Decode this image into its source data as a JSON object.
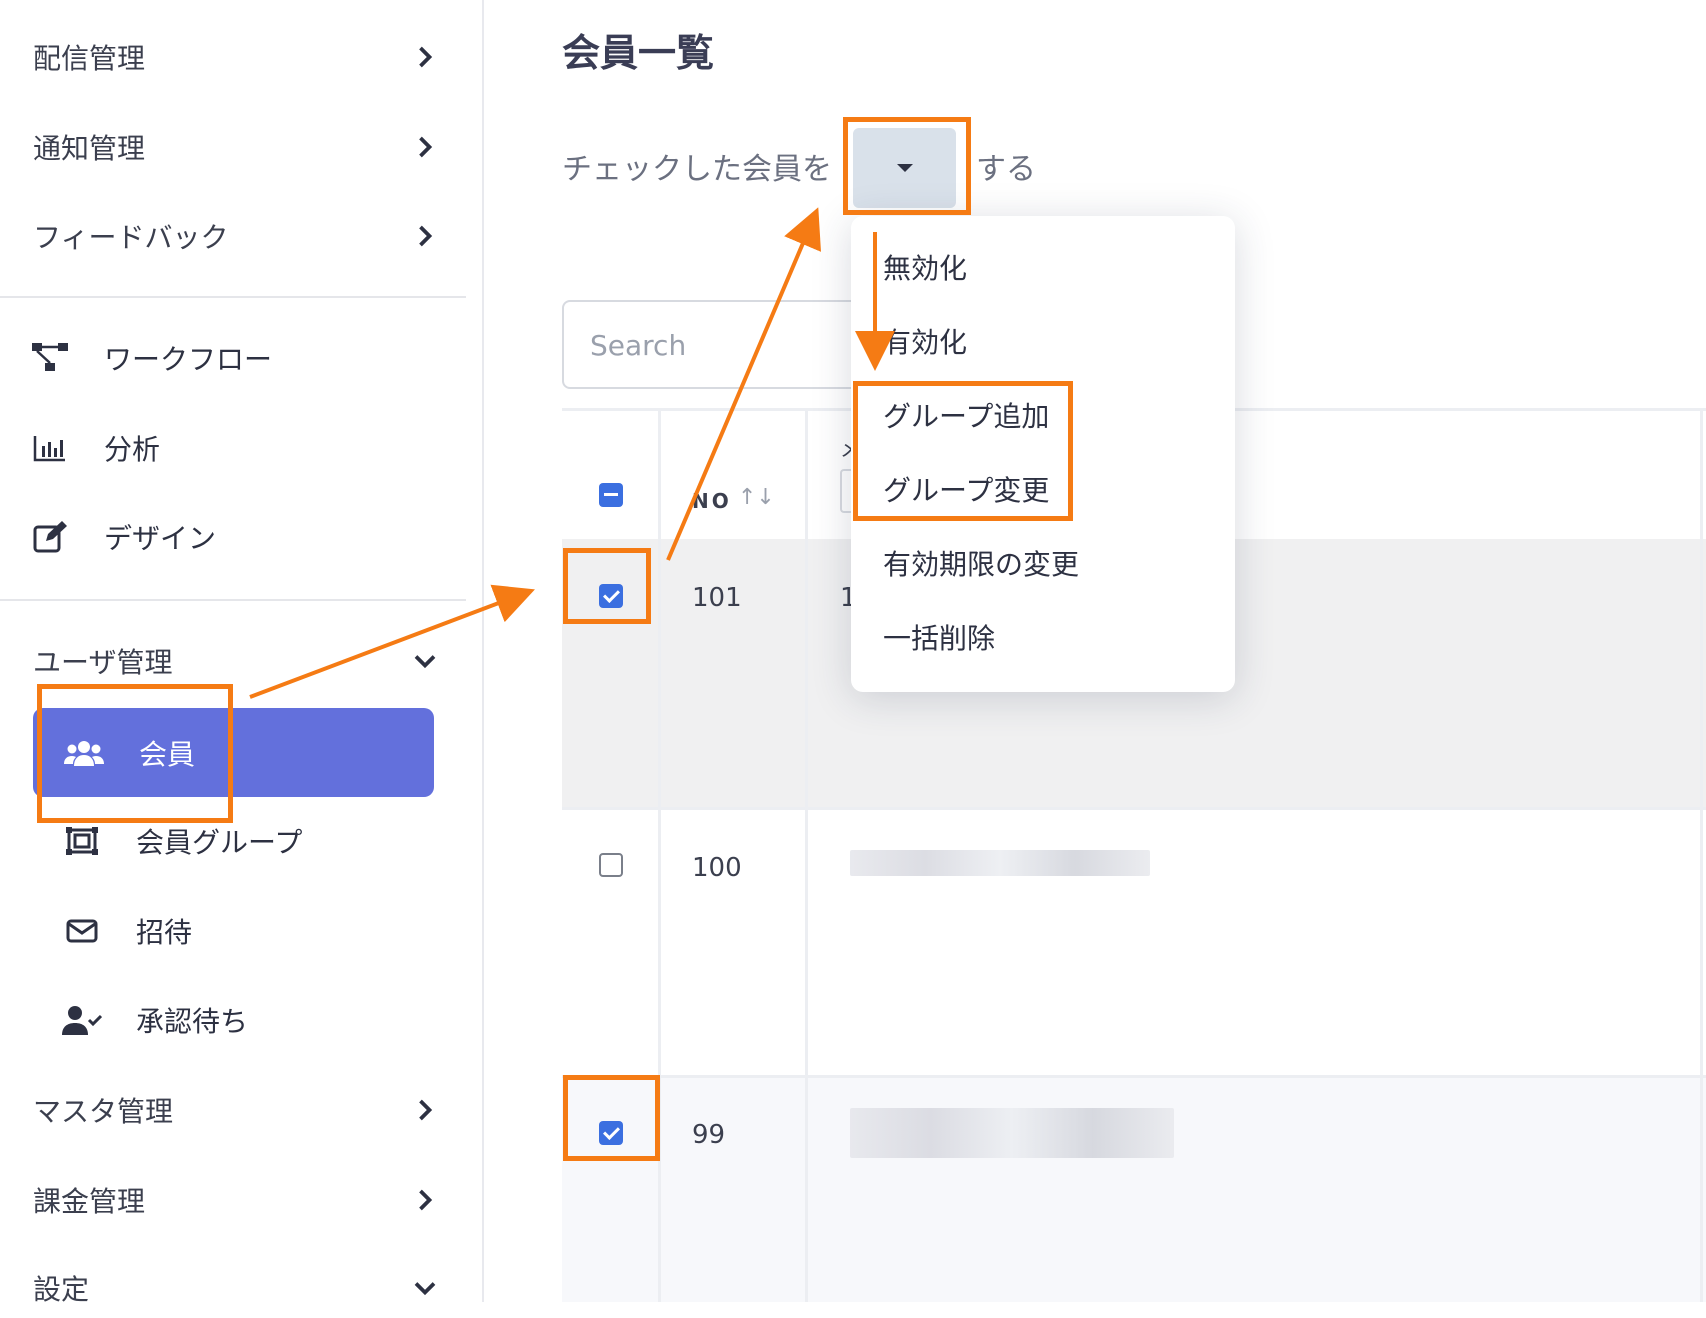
{
  "sidebar": {
    "top_items": [
      {
        "label": "配信管理"
      },
      {
        "label": "通知管理"
      },
      {
        "label": "フィードバック"
      }
    ],
    "tools": [
      {
        "label": "ワークフロー",
        "icon": "workflow-icon"
      },
      {
        "label": "分析",
        "icon": "chart-icon"
      },
      {
        "label": "デザイン",
        "icon": "edit-icon"
      }
    ],
    "user_section": {
      "label": "ユーザ管理",
      "items": [
        {
          "label": "会員",
          "icon": "users-icon",
          "active": true
        },
        {
          "label": "会員グループ",
          "icon": "group-icon"
        },
        {
          "label": "招待",
          "icon": "envelope-icon"
        },
        {
          "label": "承認待ち",
          "icon": "user-check-icon"
        }
      ]
    },
    "bottom_items": [
      {
        "label": "マスタ管理"
      },
      {
        "label": "課金管理"
      },
      {
        "label": "設定"
      }
    ],
    "active_color": "#6370dc"
  },
  "main": {
    "title": "会員一覧",
    "bulk_action": {
      "prefix": "チェックした会員を",
      "suffix": "する"
    },
    "search": {
      "placeholder": "Search"
    },
    "table": {
      "headers": {
        "no": "NO",
        "sort": "↑↓",
        "col2_partial": "メ"
      },
      "rows": [
        {
          "no": "101",
          "checked": true,
          "partial": "1"
        },
        {
          "no": "100",
          "checked": false
        },
        {
          "no": "99",
          "checked": true
        }
      ]
    }
  },
  "menu": {
    "items": [
      "無効化",
      "有効化",
      "グループ追加",
      "グループ変更",
      "有効期限の変更",
      "一括削除"
    ]
  },
  "annotation_color": "#f57b14"
}
